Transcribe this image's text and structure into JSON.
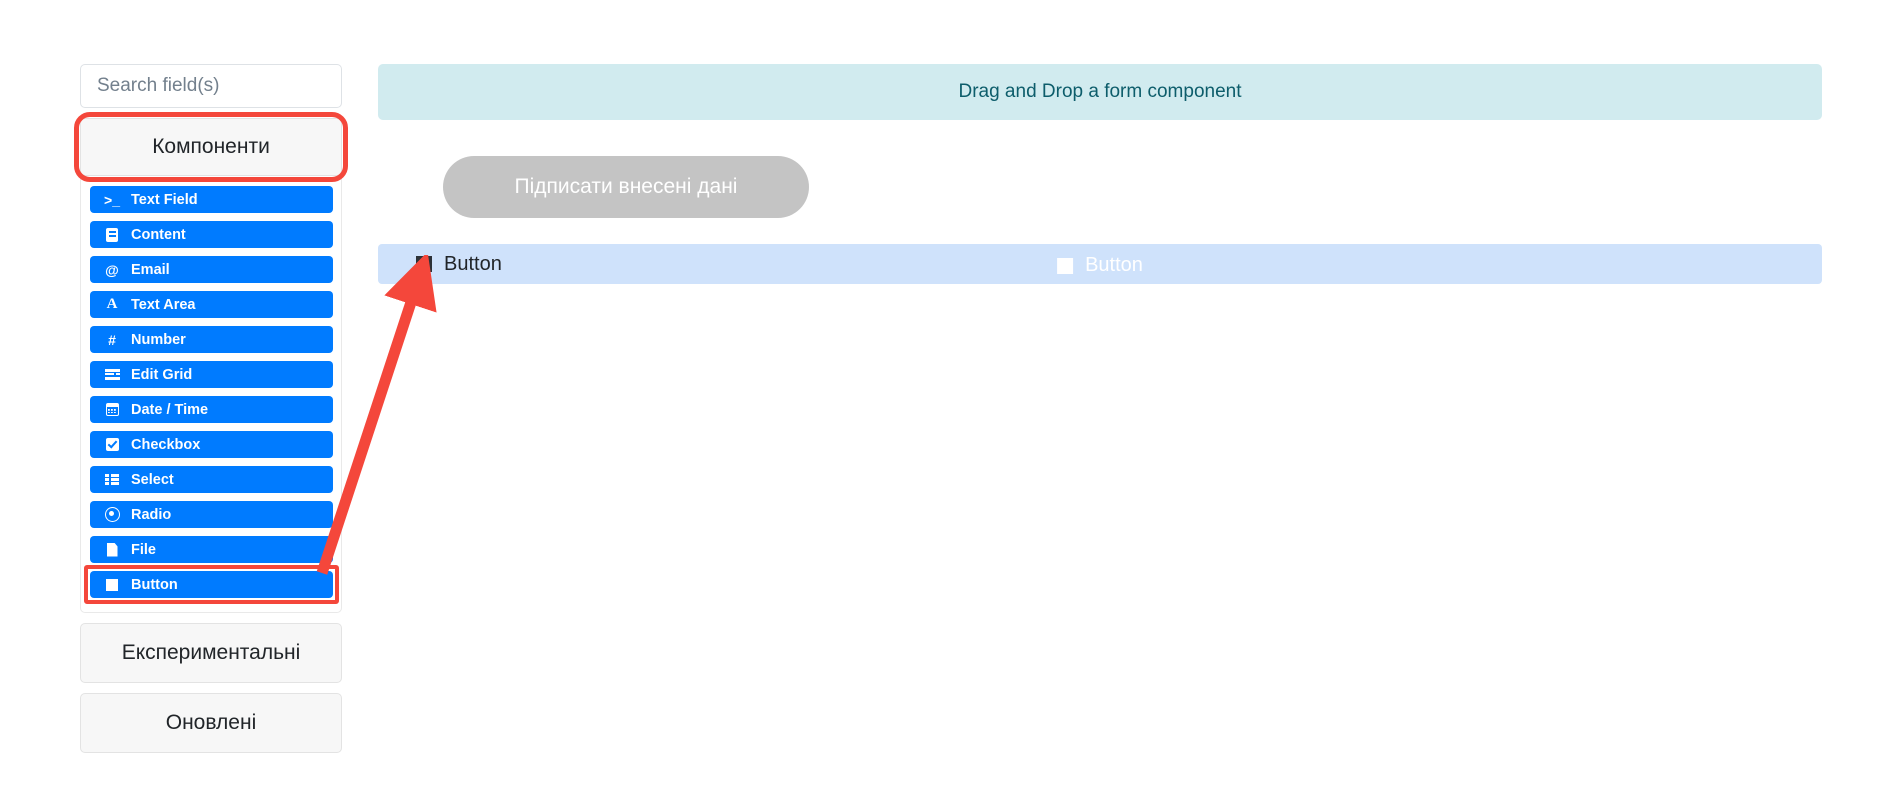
{
  "search": {
    "placeholder": "Search field(s)",
    "value": ""
  },
  "sidebar": {
    "sections": [
      {
        "label": "Компоненти",
        "highlighted": true
      },
      {
        "label": "Експериментальні",
        "highlighted": false
      },
      {
        "label": "Оновлені",
        "highlighted": false
      }
    ],
    "components": [
      {
        "label": "Text Field",
        "icon": "terminal-prompt-icon",
        "highlighted": false
      },
      {
        "label": "Content",
        "icon": "content-icon",
        "highlighted": false
      },
      {
        "label": "Email",
        "icon": "at-sign-icon",
        "highlighted": false
      },
      {
        "label": "Text Area",
        "icon": "letter-a-icon",
        "highlighted": false
      },
      {
        "label": "Number",
        "icon": "hash-icon",
        "highlighted": false
      },
      {
        "label": "Edit Grid",
        "icon": "grid-icon",
        "highlighted": false
      },
      {
        "label": "Date / Time",
        "icon": "calendar-icon",
        "highlighted": false
      },
      {
        "label": "Checkbox",
        "icon": "checkbox-icon",
        "highlighted": false
      },
      {
        "label": "Select",
        "icon": "list-icon",
        "highlighted": false
      },
      {
        "label": "Radio",
        "icon": "radio-icon",
        "highlighted": false
      },
      {
        "label": "File",
        "icon": "file-icon",
        "highlighted": false
      },
      {
        "label": "Button",
        "icon": "square-icon",
        "highlighted": true
      }
    ]
  },
  "main": {
    "dropzone_text": "Drag and Drop a form component",
    "sign_button_label": "Підписати внесені дані",
    "form_row": {
      "left_label": "Button",
      "ghost_label": "Button"
    }
  },
  "annotations": {
    "arrow_color": "#f4473b",
    "highlight_color": "#f4473b"
  },
  "colors": {
    "component_blue": "#007bff",
    "dropzone_bg": "#d1ebef",
    "row_bg": "#cfe2fb",
    "sign_button_bg": "#c4c4c4"
  }
}
